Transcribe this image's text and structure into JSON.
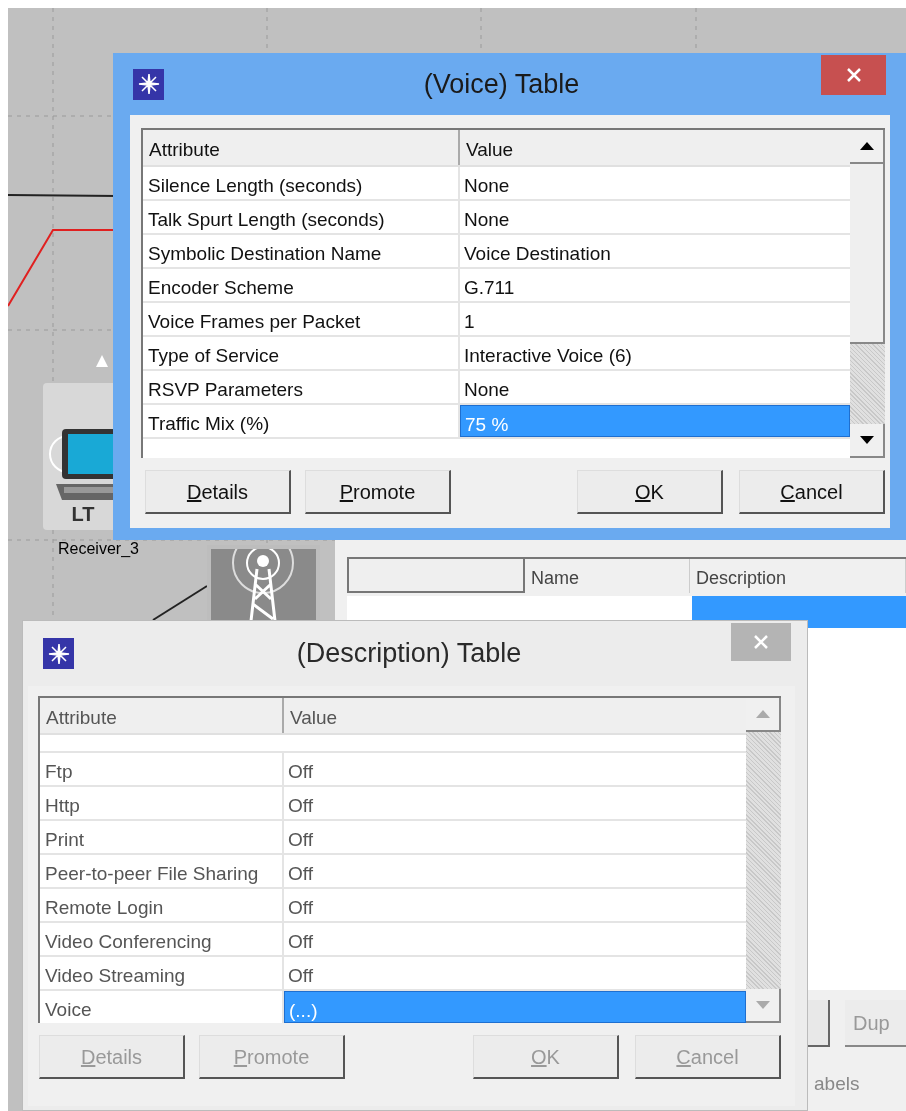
{
  "canvas": {
    "node": {
      "badge": "LT",
      "label": "Receiver_3"
    }
  },
  "back_window": {
    "columns": [
      "Name",
      "Description"
    ],
    "rows": [
      {
        "selected": true
      }
    ],
    "button": "Dup",
    "caption": "abels"
  },
  "voice_dialog": {
    "title": "(Voice) Table",
    "active": true,
    "columns": [
      "Attribute",
      "Value"
    ],
    "rows": [
      {
        "attribute": "Silence Length (seconds)",
        "value": "None",
        "selected": false
      },
      {
        "attribute": "Talk Spurt Length (seconds)",
        "value": "None",
        "selected": false
      },
      {
        "attribute": "Symbolic Destination Name",
        "value": "Voice Destination",
        "selected": false
      },
      {
        "attribute": "Encoder Scheme",
        "value": "G.711",
        "selected": false
      },
      {
        "attribute": "Voice Frames per Packet",
        "value": "1",
        "selected": false
      },
      {
        "attribute": "Type of Service",
        "value": "Interactive Voice (6)",
        "selected": false
      },
      {
        "attribute": "RSVP Parameters",
        "value": "None",
        "selected": false
      },
      {
        "attribute": "Traffic Mix (%)",
        "value": "75 %",
        "selected": true
      }
    ],
    "buttons": [
      {
        "label": "Details",
        "disabled": false
      },
      {
        "label": "Promote",
        "disabled": false
      },
      {
        "label": "OK",
        "disabled": false
      },
      {
        "label": "Cancel",
        "disabled": false
      }
    ]
  },
  "description_dialog": {
    "title": "(Description) Table",
    "active": false,
    "columns": [
      "Attribute",
      "Value"
    ],
    "rows": [
      {
        "attribute": "Ftp",
        "value": "Off",
        "selected": false
      },
      {
        "attribute": "Http",
        "value": "Off",
        "selected": false
      },
      {
        "attribute": "Print",
        "value": "Off",
        "selected": false
      },
      {
        "attribute": "Peer-to-peer File Sharing",
        "value": "Off",
        "selected": false
      },
      {
        "attribute": "Remote Login",
        "value": "Off",
        "selected": false
      },
      {
        "attribute": "Video Conferencing",
        "value": "Off",
        "selected": false
      },
      {
        "attribute": "Video Streaming",
        "value": "Off",
        "selected": false
      },
      {
        "attribute": "Voice",
        "value": "(...)",
        "selected": true
      }
    ],
    "buttons": [
      {
        "label": "Details",
        "disabled": true
      },
      {
        "label": "Promote",
        "disabled": true
      },
      {
        "label": "OK",
        "disabled": true
      },
      {
        "label": "Cancel",
        "disabled": true
      }
    ]
  }
}
